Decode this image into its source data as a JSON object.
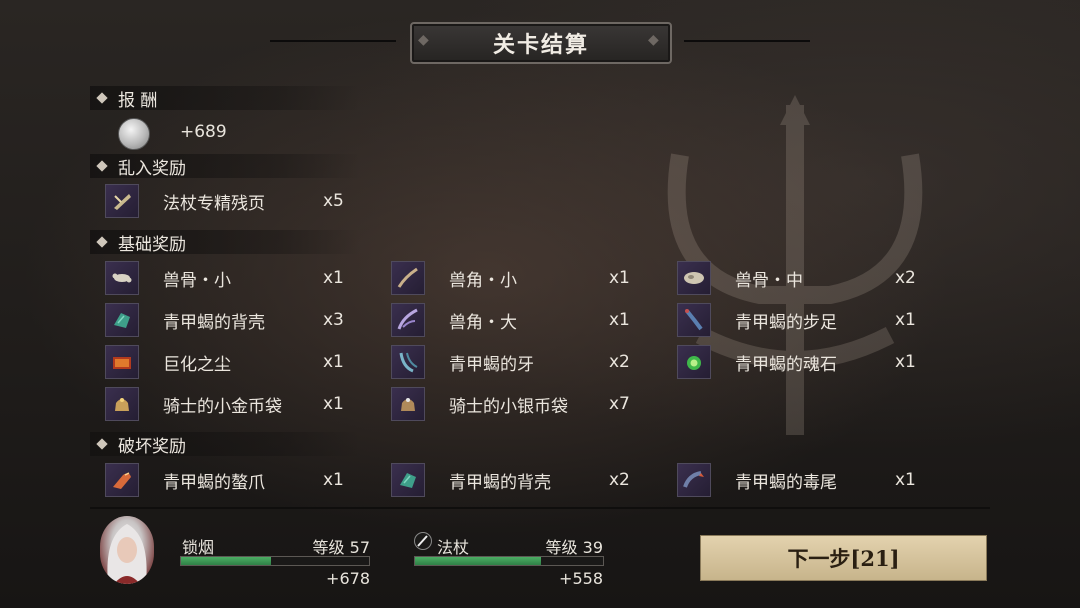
{
  "title": "关卡结算",
  "reward": {
    "header": "报  酬",
    "coin_icon": "silver-coin-icon",
    "coin_value": "+689"
  },
  "intrusion": {
    "header": "乱入奖励",
    "items": [
      {
        "name": "法杖专精残页",
        "qty": "x5",
        "icon": "staff-page-icon"
      }
    ]
  },
  "basic": {
    "header": "基础奖励",
    "items": [
      {
        "name": "兽骨・小",
        "qty": "x1",
        "icon": "small-bone-icon"
      },
      {
        "name": "兽角・小",
        "qty": "x1",
        "icon": "small-horn-icon"
      },
      {
        "name": "兽骨・中",
        "qty": "x2",
        "icon": "medium-bone-icon"
      },
      {
        "name": "青甲蝎的背壳",
        "qty": "x3",
        "icon": "scorpion-shell-icon"
      },
      {
        "name": "兽角・大",
        "qty": "x1",
        "icon": "large-horn-icon"
      },
      {
        "name": "青甲蝎的步足",
        "qty": "x1",
        "icon": "scorpion-leg-icon"
      },
      {
        "name": "巨化之尘",
        "qty": "x1",
        "icon": "giant-dust-icon"
      },
      {
        "name": "青甲蝎的牙",
        "qty": "x2",
        "icon": "scorpion-fang-icon"
      },
      {
        "name": "青甲蝎的魂石",
        "qty": "x1",
        "icon": "soul-stone-icon"
      },
      {
        "name": "骑士的小金币袋",
        "qty": "x1",
        "icon": "gold-pouch-icon"
      },
      {
        "name": "骑士的小银币袋",
        "qty": "x7",
        "icon": "silver-pouch-icon"
      }
    ]
  },
  "destroy": {
    "header": "破坏奖励",
    "items": [
      {
        "name": "青甲蝎的螯爪",
        "qty": "x1",
        "icon": "scorpion-claw-icon"
      },
      {
        "name": "青甲蝎的背壳",
        "qty": "x2",
        "icon": "scorpion-shell-icon"
      },
      {
        "name": "青甲蝎的毒尾",
        "qty": "x1",
        "icon": "scorpion-tail-icon"
      }
    ]
  },
  "character": {
    "name": "锁烟",
    "level": "等级 57",
    "exp_gain": "+678",
    "exp_fraction": 0.48
  },
  "weapon": {
    "icon": "staff-icon",
    "name": "法杖",
    "level": "等级 39",
    "exp_gain": "+558",
    "exp_fraction": 0.67
  },
  "next_button": "下一步[21]",
  "colors": {
    "accent_green": "#3f9a58",
    "button_gold": "#d6c39c",
    "icon_bg": "#2f2640"
  }
}
